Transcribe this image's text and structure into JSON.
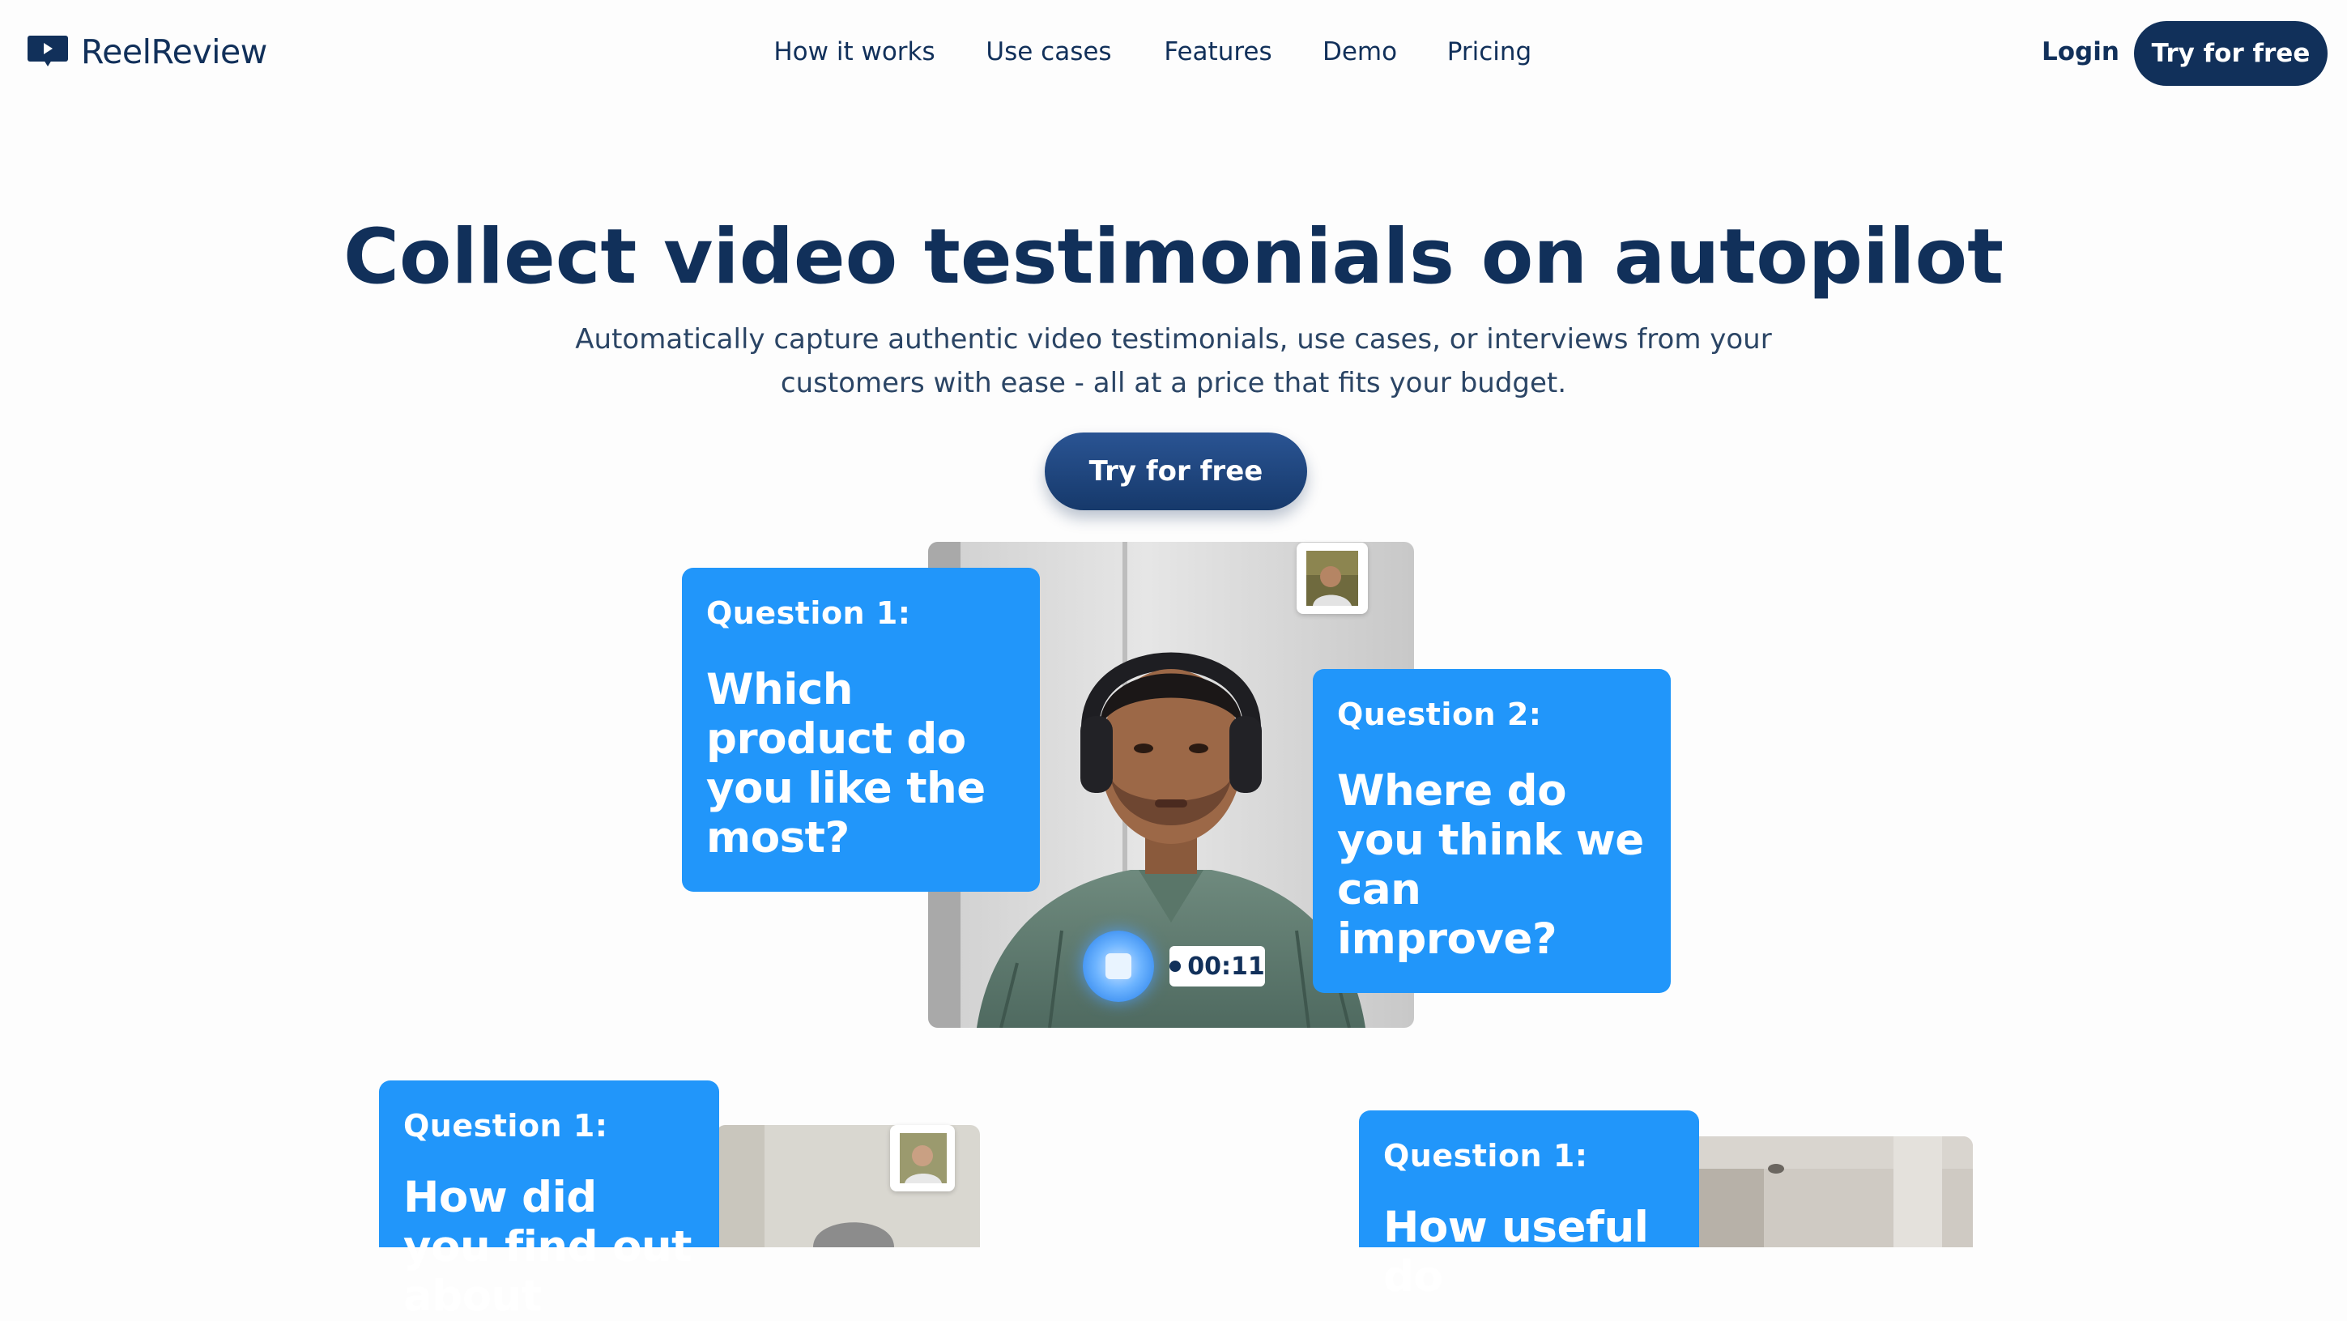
{
  "header": {
    "brand": "ReelReview",
    "nav": [
      {
        "label": "How it works"
      },
      {
        "label": "Use cases"
      },
      {
        "label": "Features"
      },
      {
        "label": "Demo"
      },
      {
        "label": "Pricing"
      }
    ],
    "login_label": "Login",
    "cta_label": "Try for free"
  },
  "hero": {
    "title": "Collect video testimonials on autopilot",
    "subtitle": "Automatically capture authentic video testimonials, use cases, or interviews from your customers with ease - all at a price that fits your budget.",
    "cta_label": "Try for free"
  },
  "demo": {
    "main": {
      "question1_label": "Question 1:",
      "question1_text": "Which product do you like the most?",
      "question2_label": "Question 2:",
      "question2_text": "Where do you think we can improve?",
      "timer": "00:11"
    },
    "left": {
      "question_label": "Question 1:",
      "question_text": "How did you find out about"
    },
    "right": {
      "question_label": "Question 1:",
      "question_text": "How useful do"
    }
  },
  "colors": {
    "brand_navy": "#11305a",
    "question_blue": "#2196fa",
    "background": "#fdfdfd"
  }
}
